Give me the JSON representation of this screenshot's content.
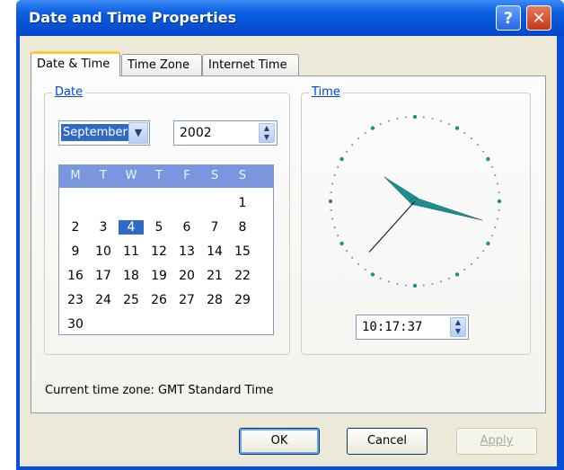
{
  "window": {
    "title": "Date and Time Properties",
    "help_glyph": "?",
    "close_glyph": "✕"
  },
  "tabs": [
    {
      "label": "Date & Time",
      "active": true
    },
    {
      "label": "Time Zone",
      "active": false
    },
    {
      "label": "Internet Time",
      "active": false
    }
  ],
  "date": {
    "group_label": "Date",
    "month": "September",
    "year": "2002",
    "weekday_headers": [
      "M",
      "T",
      "W",
      "T",
      "F",
      "S",
      "S"
    ],
    "days": [
      [
        "",
        "",
        "",
        "",
        "",
        "",
        "1"
      ],
      [
        "2",
        "3",
        "4",
        "5",
        "6",
        "7",
        "8"
      ],
      [
        "9",
        "10",
        "11",
        "12",
        "13",
        "14",
        "15"
      ],
      [
        "16",
        "17",
        "18",
        "19",
        "20",
        "21",
        "22"
      ],
      [
        "23",
        "24",
        "25",
        "26",
        "27",
        "28",
        "29"
      ],
      [
        "30",
        "",
        "",
        "",
        "",
        "",
        ""
      ]
    ],
    "selected_day": "4"
  },
  "time": {
    "group_label": "Time",
    "value": "10:17:37",
    "clock": {
      "hours": 10,
      "minutes": 17,
      "seconds": 37
    }
  },
  "status": {
    "timezone_text": "Current time zone:  GMT Standard Time"
  },
  "buttons": {
    "ok": "OK",
    "cancel": "Cancel",
    "apply": "Apply"
  },
  "colors": {
    "title_bar": "#0a5fe0",
    "selection": "#316ac5",
    "calendar_header": "#7a96df",
    "clock_hands": "#1b8f8f"
  }
}
